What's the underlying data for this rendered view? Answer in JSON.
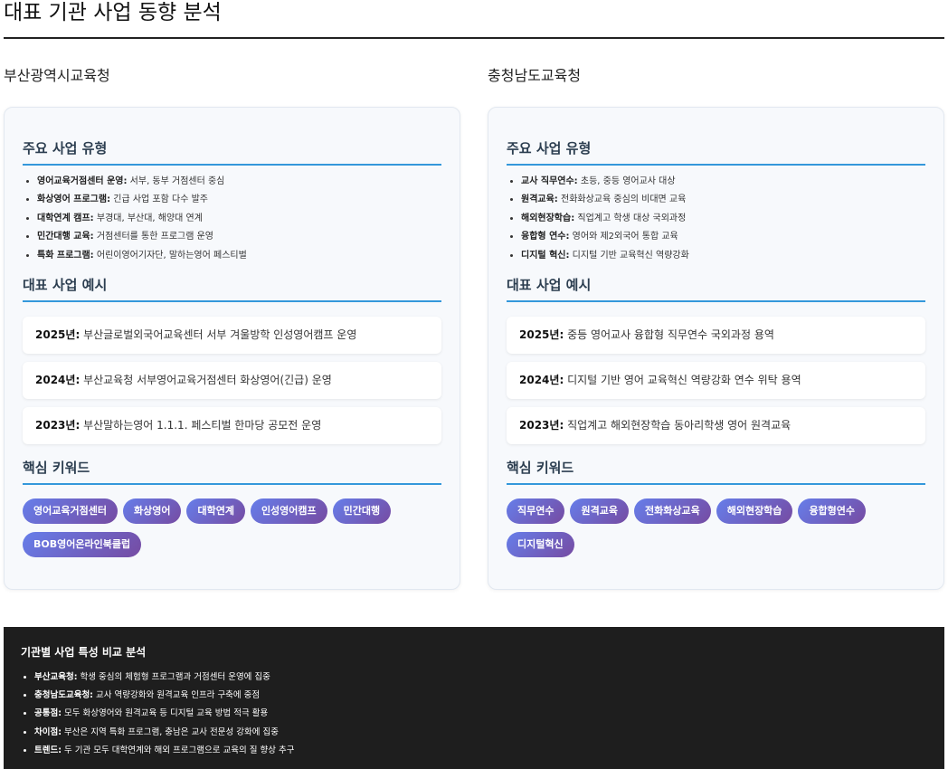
{
  "page": {
    "title": "대표 기관 사업 동향 분석"
  },
  "columns": [
    {
      "name": "부산광역시교육청",
      "types_heading": "주요 사업 유형",
      "types": [
        {
          "label": "영어교육거점센터 운영:",
          "desc": " 서부, 동부 거점센터 중심"
        },
        {
          "label": "화상영어 프로그램:",
          "desc": " 긴급 사업 포함 다수 발주"
        },
        {
          "label": "대학연계 캠프:",
          "desc": " 부경대, 부산대, 해양대 연계"
        },
        {
          "label": "민간대행 교육:",
          "desc": " 거점센터를 통한 프로그램 운영"
        },
        {
          "label": "특화 프로그램:",
          "desc": " 어린이영어기자단, 말하는영어 페스티벌"
        }
      ],
      "examples_heading": "대표 사업 예시",
      "examples": [
        {
          "year": "2025년:",
          "text": " 부산글로벌외국어교육센터 서부 겨울방학 인성영어캠프 운영"
        },
        {
          "year": "2024년:",
          "text": " 부산교육청 서부영어교육거점센터 화상영어(긴급) 운영"
        },
        {
          "year": "2023년:",
          "text": " 부산말하는영어 1.1.1. 페스티벌 한마당 공모전 운영"
        }
      ],
      "keywords_heading": "핵심 키워드",
      "keywords": [
        "영어교육거점센터",
        "화상영어",
        "대학연계",
        "인성영어캠프",
        "민간대행",
        "BOB영어온라인북클럽"
      ]
    },
    {
      "name": "충청남도교육청",
      "types_heading": "주요 사업 유형",
      "types": [
        {
          "label": "교사 직무연수:",
          "desc": " 초등, 중등 영어교사 대상"
        },
        {
          "label": "원격교육:",
          "desc": " 전화화상교육 중심의 비대면 교육"
        },
        {
          "label": "해외현장학습:",
          "desc": " 직업계고 학생 대상 국외과정"
        },
        {
          "label": "융합형 연수:",
          "desc": " 영어와 제2외국어 통합 교육"
        },
        {
          "label": "디지털 혁신:",
          "desc": " 디지털 기반 교육혁신 역량강화"
        }
      ],
      "examples_heading": "대표 사업 예시",
      "examples": [
        {
          "year": "2025년:",
          "text": " 중등 영어교사 융합형 직무연수 국외과정 용역"
        },
        {
          "year": "2024년:",
          "text": " 디지털 기반 영어 교육혁신 역량강화 연수 위탁 용역"
        },
        {
          "year": "2023년:",
          "text": " 직업계고 해외현장학습 동아리학생 영어 원격교육"
        }
      ],
      "keywords_heading": "핵심 키워드",
      "keywords": [
        "직무연수",
        "원격교육",
        "전화화상교육",
        "해외현장학습",
        "융합형연수",
        "디지털혁신"
      ]
    }
  ],
  "analysis": {
    "title": "기관별 사업 특성 비교 분석",
    "items": [
      {
        "label": "부산교육청:",
        "desc": " 학생 중심의 체험형 프로그램과 거점센터 운영에 집중"
      },
      {
        "label": "충청남도교육청:",
        "desc": " 교사 역량강화와 원격교육 인프라 구축에 중점"
      },
      {
        "label": "공통점:",
        "desc": " 모두 화상영어와 원격교육 등 디지털 교육 방법 적극 활용"
      },
      {
        "label": "차이점:",
        "desc": " 부산은 지역 특화 프로그램, 충남은 교사 전문성 강화에 집중"
      },
      {
        "label": "트렌드:",
        "desc": " 두 기관 모두 대학연계와 해외 프로그램으로 교육의 질 향상 추구"
      }
    ]
  }
}
